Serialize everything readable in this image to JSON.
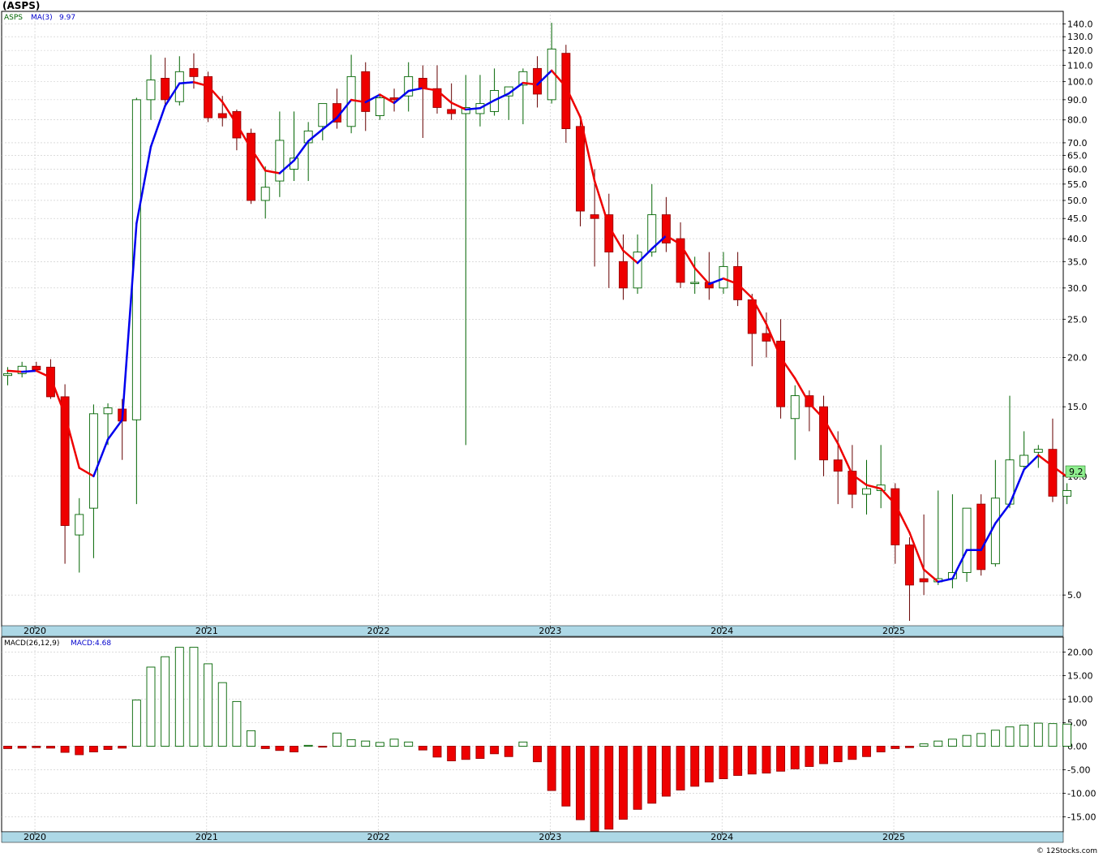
{
  "page_title": "(ASPS)",
  "watermark": "© 12Stocks.com",
  "price_panel": {
    "legend_symbol": "ASPS",
    "legend_ma_label": "MA(3)",
    "legend_ma_value": "9.97",
    "last_price_badge": "9.2",
    "y_tick_labels": [
      "140.0",
      "130.0",
      "120.0",
      "110.0",
      "100.0",
      "90.0",
      "80.0",
      "70.0",
      "65.0",
      "60.0",
      "55.0",
      "50.0",
      "45.0",
      "40.0",
      "35.0",
      "30.0",
      "25.0",
      "20.0",
      "15.0",
      "10.0",
      "5.0"
    ]
  },
  "macd_panel": {
    "legend_label": "MACD(26,12,9)",
    "legend_value": "MACD:4.68",
    "y_tick_labels": [
      "20.00",
      "15.00",
      "10.00",
      "5.00",
      "0.00",
      "-5.00",
      "-10.00",
      "-15.00"
    ]
  },
  "x_axis_labels": [
    "2020",
    "2021",
    "2022",
    "2023",
    "2024",
    "2025"
  ],
  "colors": {
    "up_candle_border": "#006400",
    "down_candle_fill": "#ee0000",
    "ma_up": "#0000ee",
    "ma_down": "#ee0000",
    "axis_band": "#add8e6",
    "badge": "#90ee90"
  },
  "chart_data": [
    {
      "type": "candlestick",
      "title": "(ASPS)",
      "scale": "log",
      "ylim": [
        4.2,
        150
      ],
      "x_ticks": [
        "2020",
        "2021",
        "2022",
        "2023",
        "2024",
        "2025"
      ],
      "series": [
        {
          "name": "ASPS",
          "ohlc": [
            [
              18.0,
              18.9,
              17.0,
              18.2
            ],
            [
              18.2,
              19.5,
              17.8,
              19.0
            ],
            [
              19.0,
              19.5,
              18.5,
              18.6
            ],
            [
              18.9,
              19.8,
              15.7,
              15.9
            ],
            [
              15.9,
              17.1,
              6.0,
              7.5
            ],
            [
              7.1,
              8.8,
              5.7,
              8.0
            ],
            [
              8.3,
              15.2,
              6.2,
              14.4
            ],
            [
              14.4,
              15.3,
              12.0,
              14.9
            ],
            [
              14.8,
              15.7,
              11.0,
              13.8
            ],
            [
              13.9,
              91.0,
              8.5,
              90.0
            ],
            [
              90.0,
              117.0,
              80.0,
              101.0
            ],
            [
              102.0,
              115.0,
              86.0,
              90.0
            ],
            [
              89.0,
              116.0,
              87.0,
              106.0
            ],
            [
              108.0,
              118.0,
              96.0,
              103.0
            ],
            [
              103.0,
              106.0,
              79.0,
              81.0
            ],
            [
              83.0,
              92.0,
              77.0,
              81.0
            ],
            [
              84.0,
              85.0,
              67.0,
              72.0
            ],
            [
              74.0,
              76.0,
              49.0,
              50.0
            ],
            [
              50.0,
              61.0,
              45.0,
              54.0
            ],
            [
              56.0,
              84.0,
              51.0,
              71.0
            ],
            [
              60.0,
              84.0,
              56.0,
              64.0
            ],
            [
              70.0,
              79.0,
              56.0,
              75.0
            ],
            [
              77.0,
              88.0,
              71.0,
              88.0
            ],
            [
              88.0,
              96.0,
              76.0,
              79.0
            ],
            [
              77.0,
              117.0,
              74.0,
              103.0
            ],
            [
              106.0,
              112.0,
              75.0,
              84.0
            ],
            [
              82.0,
              92.0,
              80.0,
              91.0
            ],
            [
              91.0,
              96.0,
              84.0,
              90.0
            ],
            [
              92.0,
              112.0,
              84.0,
              103.0
            ],
            [
              102.0,
              110.0,
              72.0,
              96.0
            ],
            [
              96.0,
              110.0,
              83.0,
              86.0
            ],
            [
              85.0,
              99.0,
              80.0,
              83.0
            ],
            [
              83.0,
              104.0,
              12.0,
              86.0
            ],
            [
              83.0,
              104.0,
              77.0,
              88.0
            ],
            [
              84.0,
              108.0,
              82.0,
              95.0
            ],
            [
              92.0,
              96.0,
              80.0,
              97.0
            ],
            [
              98.0,
              108.0,
              78.0,
              106.0
            ],
            [
              108.0,
              116.0,
              86.0,
              93.0
            ],
            [
              90.0,
              141.0,
              88.0,
              121.0
            ],
            [
              118.0,
              124.0,
              70.0,
              76.0
            ],
            [
              77.0,
              80.0,
              43.0,
              47.0
            ],
            [
              46.0,
              60.0,
              34.0,
              45.0
            ],
            [
              46.0,
              52.0,
              30.0,
              37.0
            ],
            [
              35.0,
              41.0,
              28.0,
              30.0
            ],
            [
              30.0,
              41.0,
              29.0,
              37.0
            ],
            [
              37.0,
              55.0,
              36.0,
              46.0
            ],
            [
              46.0,
              51.0,
              37.0,
              39.0
            ],
            [
              40.0,
              44.0,
              30.0,
              31.0
            ],
            [
              31.0,
              36.0,
              29.0,
              31.0
            ],
            [
              31.0,
              37.0,
              28.0,
              30.0
            ],
            [
              30.0,
              37.0,
              29.0,
              34.0
            ],
            [
              34.0,
              37.0,
              27.0,
              28.0
            ],
            [
              28.0,
              29.0,
              19.0,
              23.0
            ],
            [
              23.0,
              26.0,
              20.0,
              22.0
            ],
            [
              22.0,
              25.0,
              14.0,
              15.0
            ],
            [
              14.0,
              17.0,
              11.0,
              16.0
            ],
            [
              16.0,
              16.5,
              13.0,
              15.0
            ],
            [
              15.0,
              16.0,
              10.0,
              11.0
            ],
            [
              11.0,
              13.0,
              8.5,
              10.3
            ],
            [
              10.3,
              12.0,
              8.3,
              9.0
            ],
            [
              9.0,
              11.0,
              8.0,
              9.3
            ],
            [
              9.2,
              12.0,
              8.3,
              9.5
            ],
            [
              9.3,
              9.6,
              6.0,
              6.7
            ],
            [
              6.7,
              7.0,
              4.3,
              5.3
            ],
            [
              5.5,
              8.0,
              5.0,
              5.4
            ],
            [
              5.4,
              9.2,
              5.3,
              5.5
            ],
            [
              5.5,
              9.0,
              5.2,
              5.7
            ],
            [
              5.7,
              8.0,
              5.4,
              8.3
            ],
            [
              8.5,
              9.0,
              5.6,
              5.8
            ],
            [
              6.0,
              11.0,
              5.9,
              8.8
            ],
            [
              8.5,
              16.0,
              8.3,
              11.0
            ],
            [
              10.6,
              13.0,
              10.5,
              11.3
            ],
            [
              11.5,
              12.0,
              10.5,
              11.7
            ],
            [
              11.7,
              14.0,
              8.6,
              8.9
            ],
            [
              8.9,
              9.6,
              8.5,
              9.2
            ]
          ]
        },
        {
          "name": "MA(3)",
          "values": [
            18.5,
            18.4,
            18.5,
            17.8,
            14.3,
            10.5,
            10.0,
            12.4,
            13.9,
            43.7,
            68.4,
            86.9,
            99.0,
            99.7,
            97.5,
            88.8,
            78.0,
            67.7,
            59.5,
            58.6,
            63.1,
            70.7,
            75.7,
            81.0,
            89.9,
            88.7,
            92.7,
            88.3,
            94.7,
            96.3,
            95.0,
            88.4,
            85.0,
            85.7,
            89.7,
            93.3,
            99.3,
            98.3,
            106.7,
            97.0,
            81.3,
            56.0,
            43.0,
            37.3,
            34.7,
            37.7,
            40.7,
            38.7,
            33.7,
            30.7,
            31.7,
            30.7,
            28.3,
            24.3,
            20.0,
            17.7,
            15.3,
            14.0,
            12.1,
            10.1,
            9.5,
            9.3,
            8.5,
            7.2,
            5.8,
            5.4,
            5.5,
            6.5,
            6.5,
            7.6,
            8.5,
            10.4,
            11.3,
            10.6,
            9.97
          ],
          "color_rule": "blue when rising, red when falling"
        }
      ]
    },
    {
      "type": "bar",
      "title": "MACD(26,12,9)",
      "ylim": [
        -18,
        23
      ],
      "values": [
        -0.5,
        -0.4,
        -0.3,
        -0.4,
        -1.3,
        -1.8,
        -1.2,
        -0.7,
        -0.4,
        9.8,
        16.8,
        19.0,
        21.0,
        21.0,
        17.5,
        13.5,
        9.5,
        3.3,
        -0.5,
        -0.9,
        -1.2,
        0.2,
        -0.2,
        2.8,
        1.4,
        1.1,
        0.8,
        1.5,
        0.9,
        -0.8,
        -2.3,
        -3.1,
        -2.8,
        -2.6,
        -1.6,
        -2.2,
        0.9,
        -3.3,
        -9.4,
        -12.7,
        -15.6,
        -18.0,
        -17.6,
        -15.5,
        -13.4,
        -12.1,
        -10.6,
        -9.3,
        -8.5,
        -7.6,
        -6.9,
        -6.2,
        -5.9,
        -5.7,
        -5.3,
        -4.8,
        -4.3,
        -3.7,
        -3.3,
        -2.8,
        -2.2,
        -1.2,
        -0.5,
        -0.3,
        0.5,
        1.1,
        1.5,
        2.3,
        2.7,
        3.4,
        4.1,
        4.5,
        4.9,
        4.8,
        4.7
      ]
    }
  ]
}
